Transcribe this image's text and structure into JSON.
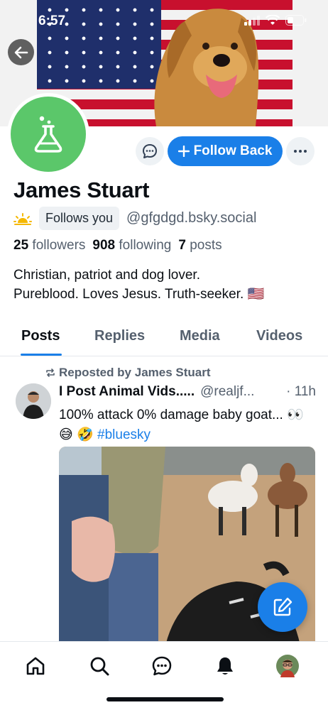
{
  "status_bar": {
    "time": "6:57"
  },
  "profile": {
    "display_name": "James Stuart",
    "follows_you_badge": "Follows you",
    "handle": "@gfgdgd.bsky.social",
    "followers_count": "25",
    "followers_label": "followers",
    "following_count": "908",
    "following_label": "following",
    "posts_count": "7",
    "posts_label": "posts",
    "bio_line1": "Christian, patriot and dog lover.",
    "bio_line2": "Pureblood. Loves Jesus. Truth-seeker. 🇺🇸",
    "avatar_color": "#5bc76a"
  },
  "actions": {
    "follow_back_label": "Follow Back",
    "follow_icon": "plus-icon",
    "more_icon": "ellipsis-icon",
    "message_icon": "chat-bubble-icon"
  },
  "tabs": [
    {
      "label": "Posts",
      "active": true
    },
    {
      "label": "Replies",
      "active": false
    },
    {
      "label": "Media",
      "active": false
    },
    {
      "label": "Videos",
      "active": false
    }
  ],
  "post": {
    "repost_label": "Reposted by James Stuart",
    "author": "I Post Animal Vids.....",
    "handle": "@realjf...",
    "time": "· 11h",
    "text_main": "100% attack 0% damage baby goat... 👀 😅 🤣",
    "hashtag": "#bluesky"
  },
  "colors": {
    "accent": "#1a7fe8",
    "text_primary": "#0b0f14",
    "text_secondary": "#55606e"
  },
  "nav": {
    "items": [
      "home-icon",
      "search-icon",
      "chat-icon",
      "notifications-bell-icon",
      "profile-avatar"
    ]
  }
}
